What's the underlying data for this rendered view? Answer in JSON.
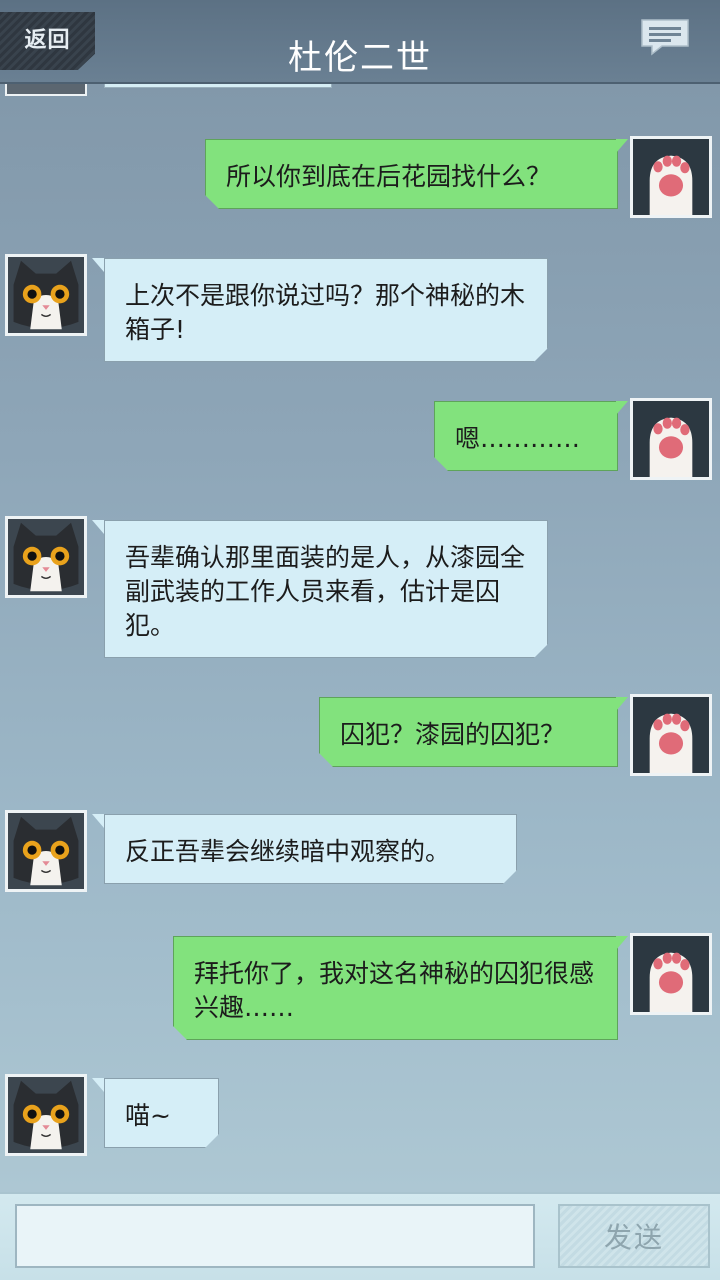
{
  "header": {
    "back_label": "返回",
    "title": "杜伦二世"
  },
  "messages": [
    {
      "side": "right",
      "text": "所以你到底在后花园找什么？"
    },
    {
      "side": "left",
      "text": "上次不是跟你说过吗？那个神秘的木箱子!"
    },
    {
      "side": "right",
      "text": "嗯…………"
    },
    {
      "side": "left",
      "text": "吾辈确认那里面装的是人，从漆园全副武装的工作人员来看，估计是囚犯。"
    },
    {
      "side": "right",
      "text": "囚犯？漆园的囚犯？"
    },
    {
      "side": "left",
      "text": "反正吾辈会继续暗中观察的。"
    },
    {
      "side": "right",
      "text": "拜托你了，我对这名神秘的囚犯很感兴趣……"
    },
    {
      "side": "left",
      "text": "喵~"
    }
  ],
  "input": {
    "value": "",
    "placeholder": "",
    "send_label": "发送"
  },
  "icons": {
    "header_right": "message-icon",
    "left_avatar": "cat-avatar",
    "right_avatar": "paw-avatar"
  },
  "colors": {
    "left_bubble": "#d5eef7",
    "right_bubble": "#82e27d",
    "header": "#627789"
  }
}
